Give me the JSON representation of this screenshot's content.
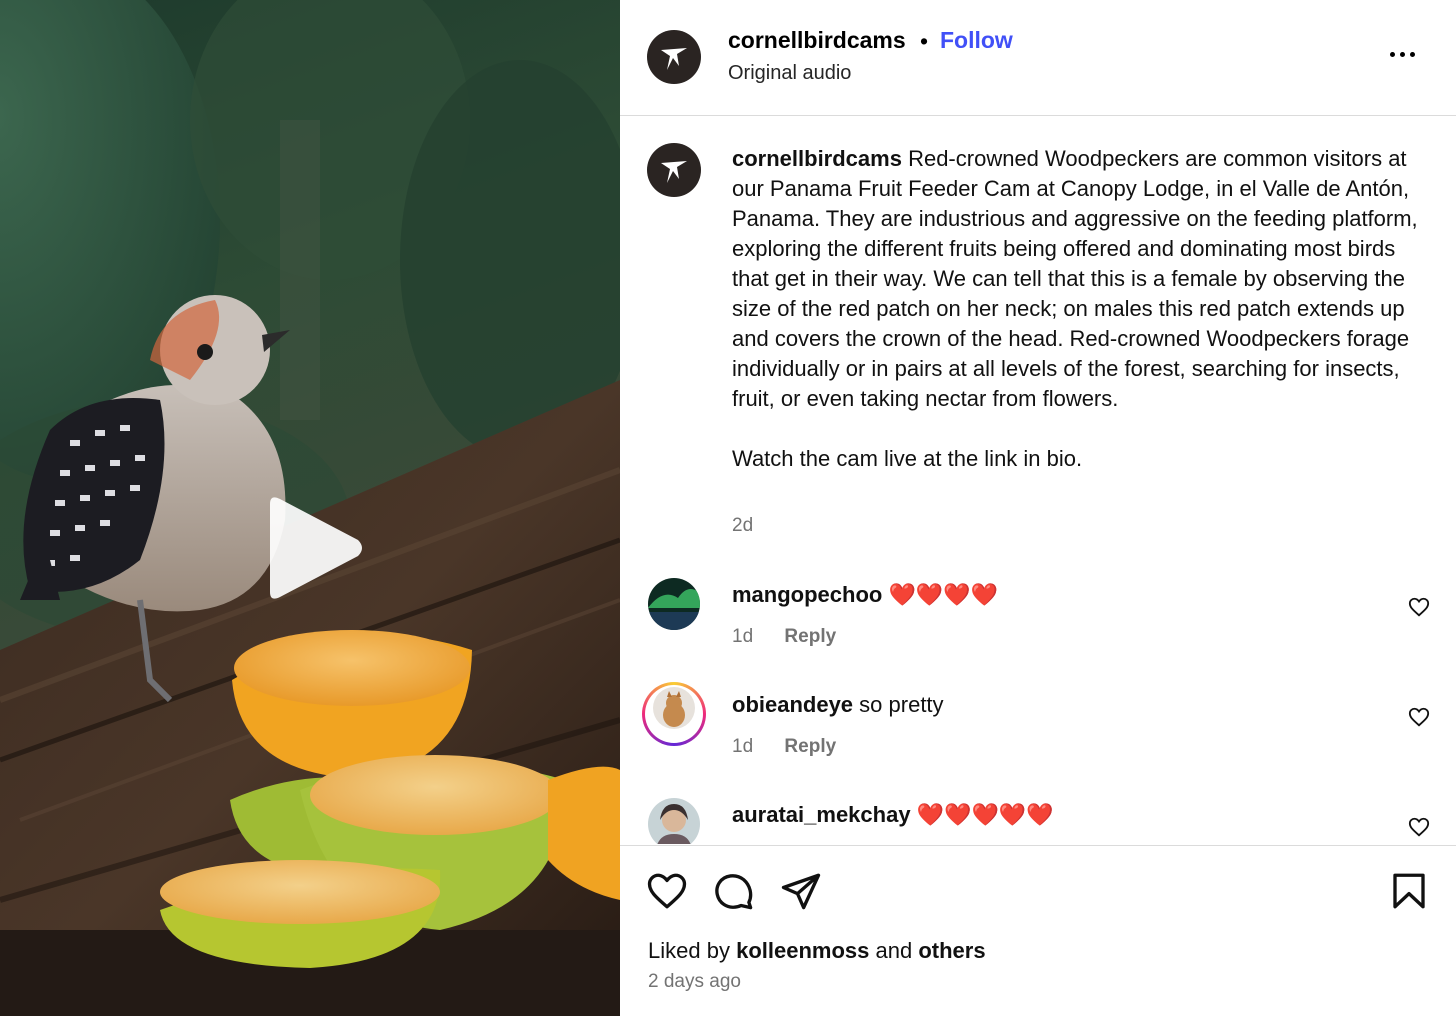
{
  "post": {
    "username": "cornellbirdcams",
    "separator": "•",
    "follow_label": "Follow",
    "audio": "Original audio"
  },
  "caption": {
    "username": "cornellbirdcams",
    "text": "Red-crowned Woodpeckers are common visitors at our Panama Fruit Feeder Cam at Canopy Lodge, in el Valle de Antón, Panama. They are industrious and aggressive on the feeding platform, exploring the different fruits being offered and dominating most birds that get in their way. We can tell that this is a female by observing the size of the red patch on her neck; on males this red patch extends up and covers the crown of the head. Red-crowned Woodpeckers forage individually or in pairs at all levels of the forest, searching for insects, fruit, or even taking nectar from flowers.",
    "watch": "Watch the cam live at the link in bio.",
    "time": "2d"
  },
  "comments": [
    {
      "username": "mangopechoo",
      "text": "",
      "emoji": "❤️❤️❤️❤️",
      "time": "1d",
      "reply": "Reply"
    },
    {
      "username": "obieandeye",
      "text": "so pretty",
      "emoji": "",
      "time": "1d",
      "reply": "Reply"
    },
    {
      "username": "auratai_mekchay",
      "text": "",
      "emoji": "❤️❤️❤️❤️❤️",
      "time": "",
      "reply": ""
    }
  ],
  "footer": {
    "liked_prefix": "Liked by",
    "liked_user": "kolleenmoss",
    "liked_and": "and",
    "liked_others": "others",
    "time": "2 days ago"
  },
  "icons": {
    "brand_avatar": "hummingbird-logo-icon",
    "more": "more-options-icon",
    "comment_like": "heart-outline-icon",
    "like": "heart-icon",
    "comment": "comment-bubble-icon",
    "share": "paper-plane-icon",
    "save": "bookmark-icon",
    "play": "play-icon"
  },
  "colors": {
    "follow": "#4150f7",
    "muted_text": "#737373",
    "heart_emoji": "#e3111b",
    "divider": "#dbdbdb"
  }
}
